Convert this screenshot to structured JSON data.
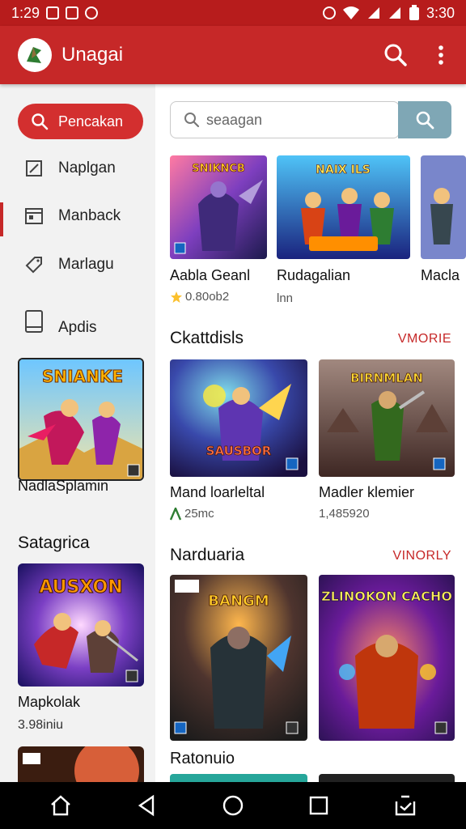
{
  "status": {
    "time": "1:29",
    "battery_time": "3:30"
  },
  "app": {
    "title": "Unagai"
  },
  "sidebar": {
    "search_label": "Pencakan",
    "items": [
      {
        "label": "Naplgan",
        "icon": "edit-icon"
      },
      {
        "label": "Manback",
        "icon": "window-icon"
      },
      {
        "label": "Marlagu",
        "icon": "tag-icon"
      },
      {
        "label": "Apdis",
        "icon": "book-icon"
      }
    ],
    "featured": {
      "title": "NadlaSplamin",
      "art_text": "SNIANKE"
    },
    "section_title": "Satagrica",
    "card2": {
      "title": "Mapkolak",
      "meta": "3.98iniu",
      "art_text": "AUSXON"
    }
  },
  "main": {
    "search_placeholder": "seaagan",
    "row1": [
      {
        "title": "Aabla Geanl",
        "meta": "0.80ob2",
        "art_text": "SNIKNCB"
      },
      {
        "title": "Rudagalian",
        "meta": "lnn",
        "art_text": "NAIX  ILS"
      },
      {
        "title": "Macla",
        "meta": ""
      }
    ],
    "section1": {
      "title": "Ckattdisls",
      "link": "VMORIE"
    },
    "row2": [
      {
        "title": "Mand loarleltal",
        "meta": "25mc",
        "art_text": "SAUSBOR"
      },
      {
        "title": "Madler klemier",
        "meta": "1,485920",
        "art_text": "BIRNMLAN"
      }
    ],
    "section2": {
      "title": "Narduaria",
      "link": "VINORLY"
    },
    "row3": [
      {
        "art_text": "BANGM"
      },
      {
        "art_text": "ZLINOKON CACHO"
      }
    ],
    "section3": {
      "title": "Ratonuio"
    }
  }
}
